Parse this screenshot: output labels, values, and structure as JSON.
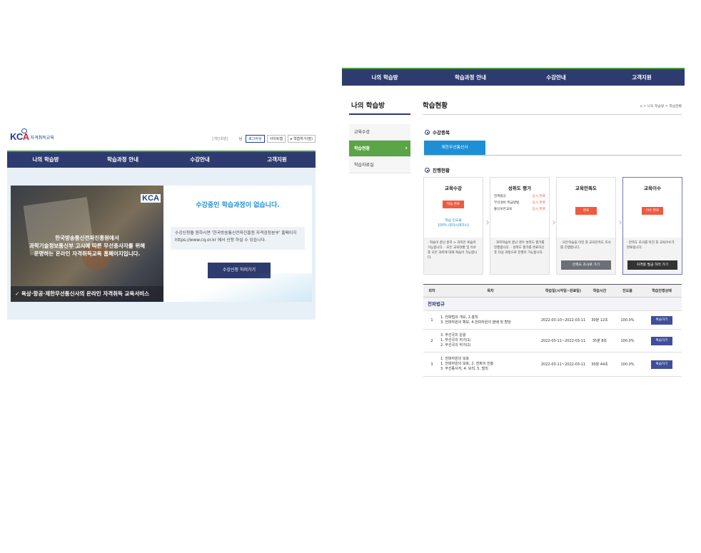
{
  "left": {
    "logo": {
      "mark_kc": "KC",
      "mark_a": "A",
      "sub": "자격취득교육"
    },
    "toplinks": {
      "personal": "[개인회원]",
      "greet": "님",
      "logout": "로그아웃",
      "sitemap": "사이트맵",
      "my_study": "▸ 학습하기(잠)"
    },
    "nav": [
      "나의 학습방",
      "학습과정 안내",
      "수강안내",
      "고객지원"
    ],
    "banner": {
      "kca": "KCA",
      "text_line1": "한국방송통신전파진흥원에서",
      "text_line2": "과학기술정보통신부 고시에 따른 무선종사자를 위해",
      "text_line3": "운영하는 온라인 자격취득교육 홈페이지입니다.",
      "bar": "✓ 육상·항공·제한무선통신사의 온라인 자격취득 교육서비스"
    },
    "box": {
      "heading": "수강중인 학습과정이 없습니다.",
      "info": "수강신청을 원하시면 '한국방송통신전파진흥원 자격검정본부' 홈페이지 https://www.cq.or.kr 에서 신청 하실 수 있습니다.",
      "button": "수강신청 하러가기"
    }
  },
  "right": {
    "nav": [
      "나의 학습방",
      "학습과정 안내",
      "수강안내",
      "고객지원"
    ],
    "sidebar": {
      "title": "나의 학습방",
      "items": [
        "교육수강",
        "학습현황",
        "학습자료실"
      ],
      "active_index": 1
    },
    "main": {
      "title": "학습현황",
      "breadcrumb": "⌂ > 나의 학습방 > 학습현황",
      "section_course": "수강종목",
      "course_tab": "제한무선통신사",
      "section_progress": "진행현황"
    },
    "steps": [
      {
        "title": "교육수강",
        "badge": "학습 완료",
        "rate": "학습 진도율",
        "rate_value": "100% (8차시/8차시)",
        "notes": "· 학습이 끝난 종목 > 과목은 복습이 가능합니다. · 모든 교육현황 및 이수 후 모든 과목에 대해 복습이 가능합니다."
      },
      {
        "title": "성취도 평가",
        "rows": [
          {
            "name": "전파법규",
            "status": "응시 완료"
          },
          {
            "name": "무선설비 취급방법",
            "status": "응시 완료"
          },
          {
            "name": "통신보안교육",
            "status": "응시 완료"
          }
        ],
        "notes": "· 과목학습이 끝난 경우 성취도 평가를 진행합니다. · 성취도 평가를 완료하신 후 다음 과정으로 진행이 가능합니다."
      },
      {
        "title": "교육만족도",
        "badge": "완료",
        "notes": "· 모든학습을 마친 후 교육만족도 조사를 진행합니다.",
        "button": "만족도 조사로 가기"
      },
      {
        "title": "교육이수",
        "badge": "이수 완료",
        "notes": "· 만족도 조사를 마친 후 교육이수가 완료됩니다.",
        "button": "자격증 발급 하러 가기"
      }
    ],
    "table": {
      "headers": [
        "회차",
        "목차",
        "학습일(시작일~완료일)",
        "학습시간",
        "진도율",
        "학습진행상태"
      ],
      "group": "전파법규",
      "rows": [
        {
          "no": "1",
          "content": [
            "1. 전파법의 개요, 2.총칙",
            "3. 전파자원의 확보, 4.전파자원의 분배 및 할당"
          ],
          "period": "2022-03-10~2022-03-11",
          "time": "30분 12초",
          "progress": "100.0%",
          "button": "복습하기"
        },
        {
          "no": "2",
          "content": [
            "3. 무선국의 운용",
            "1. 무선국의 허가(1)",
            "2. 무선국의 허가(2)"
          ],
          "period": "2022-03-11~2022-03-11",
          "time": "35분 8초",
          "progress": "100.0%",
          "button": "복습하기"
        },
        {
          "no": "3",
          "content": [
            "1. 전파자원의 보호",
            "1. 전파자원의 보호, 2. 전파의 진흥",
            "3. 무선종사자, 4. 보칙, 5. 벌칙"
          ],
          "period": "2022-03-11~2022-03-11",
          "time": "30분 44초",
          "progress": "100.0%",
          "button": "복습하기"
        }
      ]
    }
  }
}
